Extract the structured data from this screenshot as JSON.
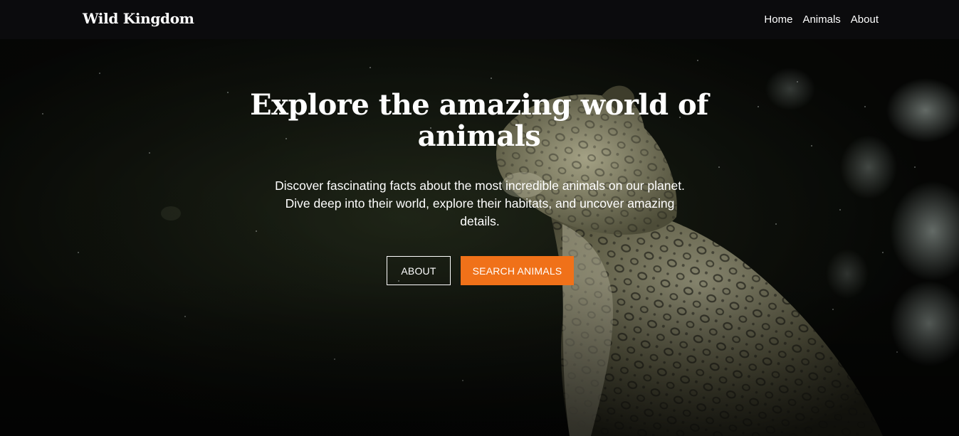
{
  "nav": {
    "brand": "Wild Kingdom",
    "links": [
      {
        "label": "Home"
      },
      {
        "label": "Animals"
      },
      {
        "label": "About"
      }
    ]
  },
  "hero": {
    "title": "Explore the amazing world of animals",
    "subtitle": "Discover fascinating facts about the most incredible animals on our planet. Dive deep into their world, explore their habitats, and uncover amazing details.",
    "buttons": {
      "about_label": "ABOUT",
      "search_label": "SEARCH ANIMALS"
    },
    "background_subject": "snow-leopard-photo"
  },
  "colors": {
    "nav_background": "#0b0b0d",
    "accent": "#f07119",
    "text": "#ffffff"
  }
}
